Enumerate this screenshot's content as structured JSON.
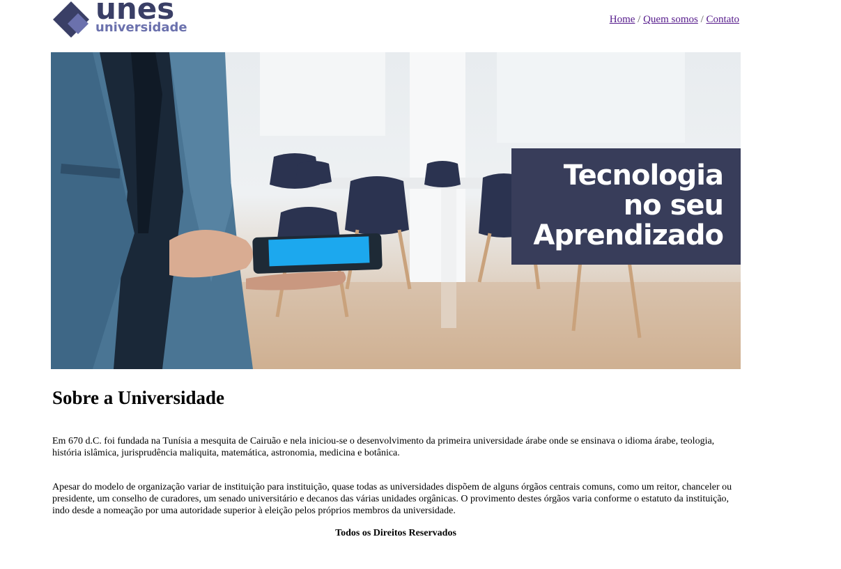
{
  "header": {
    "logo_primary": "unes",
    "logo_secondary": "universidade",
    "nav": [
      {
        "label": "Home"
      },
      {
        "label": "Quem somos"
      },
      {
        "label": " Contato"
      }
    ],
    "separator": "/"
  },
  "banner": {
    "line1": "Tecnologia",
    "line2": "no seu",
    "line3": "Aprendizado",
    "box_color": "#383d5a"
  },
  "main": {
    "title": "Sobre a Universidade",
    "paragraphs": [
      "Em 670 d.C. foi fundada na Tunísia a mesquita de Cairuão e nela iniciou-se o desenvolvimento da primeira universidade árabe onde se ensinava o idioma árabe, teologia, história islâmica, jurisprudência maliquita, matemática, astronomia, medicina e botânica.",
      "Apesar do modelo de organização variar de instituição para instituição, quase todas as universidades dispõem de alguns órgãos centrais comuns, como um reitor, chanceler ou presidente, um conselho de curadores, um senado universitário e decanos das várias unidades orgânicas. O provimento destes órgãos varia conforme o estatuto da instituição, indo desde a nomeação por uma autoridade superior à eleição pelos próprios membros da universidade."
    ]
  },
  "footer": {
    "text": "Todos os Direitos Reservados"
  },
  "colors": {
    "brand_dark": "#3a3f66",
    "brand_light": "#6b71ad",
    "link_visited": "#551a8b"
  }
}
